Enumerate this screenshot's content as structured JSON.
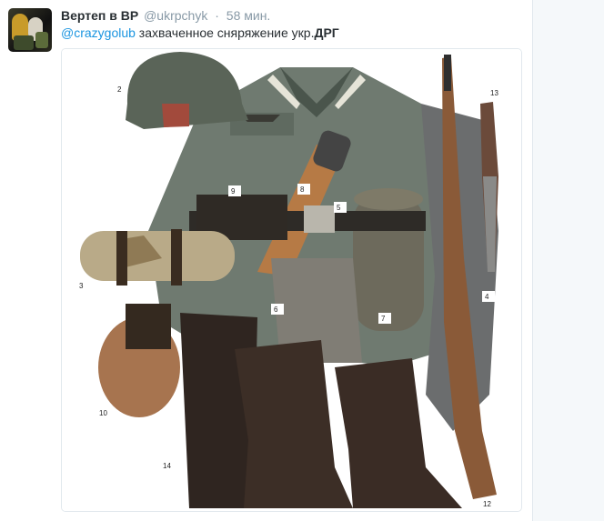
{
  "author": {
    "fullname": "Вертеп в ВР",
    "username": "@ukrpchyk",
    "separator": "·",
    "time": "58 мин."
  },
  "tweet": {
    "mention": "@crazygolub",
    "text": " захваченное сняряжение укр.",
    "bold": "ДРГ"
  },
  "media": {
    "callouts": [
      "2",
      "13",
      "9",
      "8",
      "5",
      "3",
      "6",
      "7",
      "4",
      "10",
      "14",
      "12"
    ]
  },
  "colors": {
    "link": "#1b95e0",
    "text": "#292f33",
    "muted": "#8899a6",
    "border": "#e1e8ed"
  }
}
